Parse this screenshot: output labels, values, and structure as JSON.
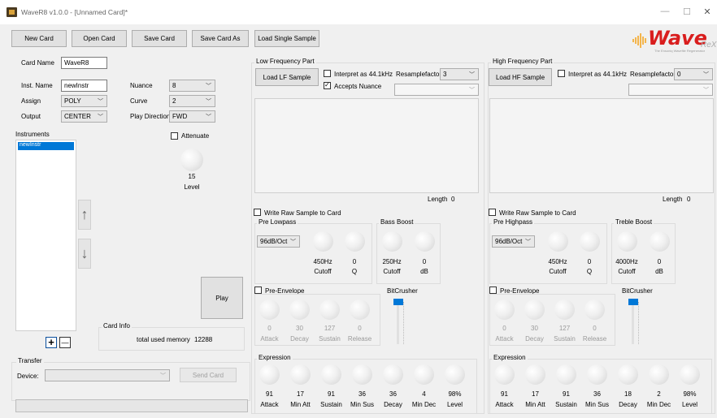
{
  "window": {
    "title": "WaveR8 v1.0.0 - [Unnamed Card]*",
    "controls": [
      "—",
      "☐",
      "✕"
    ]
  },
  "toolbar": {
    "new_card": "New Card",
    "open_card": "Open Card",
    "save_card": "Save Card",
    "save_card_as": "Save Card As",
    "load_single_sample": "Load Single Sample"
  },
  "logo": {
    "text": "Wave",
    "suffix": "ReX",
    "tagline": "The Ensoniq Wavefile Regenerator"
  },
  "card": {
    "name_label": "Card Name",
    "name_value": "WaveR8"
  },
  "inst": {
    "name_label": "Inst. Name",
    "name_value": "newInstr",
    "assign_label": "Assign",
    "assign_value": "POLY",
    "output_label": "Output",
    "output_value": "CENTER",
    "nuance_label": "Nuance",
    "nuance_value": "8",
    "curve_label": "Curve",
    "curve_value": "2",
    "playdir_label": "Play Direction",
    "playdir_value": "FWD",
    "attenuate_label": "Attenuate",
    "level_value": "15",
    "level_label": "Level"
  },
  "instruments": {
    "title": "Instruments",
    "items": [
      "newInstr"
    ],
    "add": "+",
    "remove": "—"
  },
  "play": "Play",
  "cardinfo": {
    "title": "Card Info",
    "memory_label": "total used memory",
    "memory_value": "12288"
  },
  "transfer": {
    "title": "Transfer",
    "device_label": "Device:",
    "device_value": "",
    "send": "Send Card"
  },
  "lf": {
    "title": "Low Frequency Part",
    "load": "Load LF Sample",
    "interpret": "Interpret as 44.1kHz",
    "accepts": "Accepts Nuance",
    "resample_label": "Resamplefactor",
    "resample_value": "3",
    "length_label": "Length",
    "length_value": "0",
    "write_raw": "Write Raw Sample to Card",
    "filter_title": "Pre Lowpass",
    "filter_slope": "96dB/Oct",
    "filter_cutoff": "450Hz",
    "filter_q": "0",
    "cutoff_label": "Cutoff",
    "q_label": "Q",
    "boost_title": "Bass Boost",
    "boost_freq": "250Hz",
    "boost_db": "0",
    "boost_cutoff_label": "Cutoff",
    "db_label": "dB",
    "env_label": "Pre-Envelope",
    "env": [
      {
        "v": "0",
        "l": "Attack"
      },
      {
        "v": "30",
        "l": "Decay"
      },
      {
        "v": "127",
        "l": "Sustain"
      },
      {
        "v": "0",
        "l": "Release"
      }
    ],
    "bitcrusher": "BitCrusher",
    "expr_title": "Expression",
    "expr": [
      {
        "v": "91",
        "l": "Attack"
      },
      {
        "v": "17",
        "l": "Min Att"
      },
      {
        "v": "91",
        "l": "Sustain"
      },
      {
        "v": "36",
        "l": "Min Sus"
      },
      {
        "v": "36",
        "l": "Decay"
      },
      {
        "v": "4",
        "l": "Min Dec"
      },
      {
        "v": "98%",
        "l": "Level"
      }
    ]
  },
  "hf": {
    "title": "High Frequency Part",
    "load": "Load HF Sample",
    "interpret": "Interpret as 44.1kHz",
    "resample_label": "Resamplefactor",
    "resample_value": "0",
    "length_label": "Length",
    "length_value": "0",
    "write_raw": "Write Raw Sample to Card",
    "filter_title": "Pre Highpass",
    "filter_slope": "96dB/Oct",
    "filter_cutoff": "450Hz",
    "filter_q": "0",
    "cutoff_label": "Cutoff",
    "q_label": "Q",
    "boost_title": "Treble Boost",
    "boost_freq": "4000Hz",
    "boost_db": "0",
    "boost_cutoff_label": "Cutoff",
    "db_label": "dB",
    "env_label": "Pre-Envelope",
    "env": [
      {
        "v": "0",
        "l": "Attack"
      },
      {
        "v": "30",
        "l": "Decay"
      },
      {
        "v": "127",
        "l": "Sustain"
      },
      {
        "v": "0",
        "l": "Release"
      }
    ],
    "bitcrusher": "BitCrusher",
    "expr_title": "Expression",
    "expr": [
      {
        "v": "91",
        "l": "Attack"
      },
      {
        "v": "17",
        "l": "Min Att"
      },
      {
        "v": "91",
        "l": "Sustain"
      },
      {
        "v": "36",
        "l": "Min Sus"
      },
      {
        "v": "18",
        "l": "Decay"
      },
      {
        "v": "2",
        "l": "Min Dec"
      },
      {
        "v": "98%",
        "l": "Level"
      }
    ]
  }
}
